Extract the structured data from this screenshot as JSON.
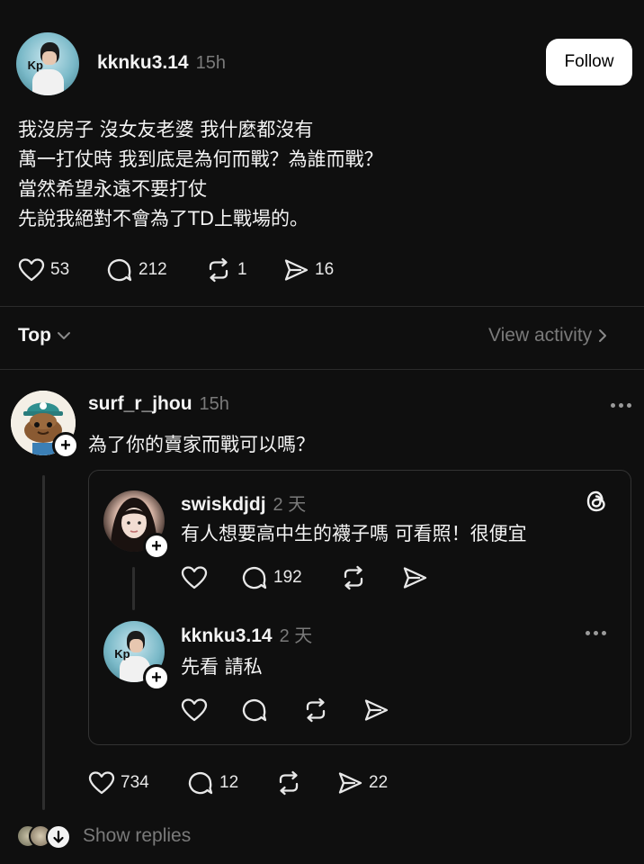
{
  "post": {
    "username": "kknku3.14",
    "time": "15h",
    "follow_label": "Follow",
    "lines": [
      "我沒房子 沒女友老婆 我什麼都沒有",
      "萬一打仗時 我到底是為何而戰？為誰而戰？",
      "當然希望永遠不要打仗",
      "先說我絕對不會為了TD上戰場的。"
    ],
    "likes": "53",
    "comments": "212",
    "reposts": "1",
    "shares": "16"
  },
  "sort": {
    "label": "Top",
    "view_activity": "View activity"
  },
  "reply": {
    "username": "surf_r_jhou",
    "time": "15h",
    "text": "為了你的賣家而戰可以嗎？",
    "likes": "734",
    "comments": "12",
    "shares": "22",
    "show_replies": "Show replies"
  },
  "quoted": {
    "post1": {
      "username": "swiskdjdj",
      "time": "2 天",
      "text": "有人想要高中生的襪子嗎 可看照！很便宜",
      "comments": "192"
    },
    "post2": {
      "username": "kknku3.14",
      "time": "2 天",
      "text": "先看 請私"
    }
  },
  "colors": {
    "background": "#0f0f0f",
    "text": "#f3f3f3",
    "muted": "#7a7a7a",
    "divider": "#2b2b2b"
  },
  "icons": [
    "heart-icon",
    "comment-icon",
    "repost-icon",
    "share-icon",
    "chevron-down-icon",
    "chevron-right-icon",
    "threads-logo-icon",
    "more-icon",
    "plus-icon"
  ]
}
